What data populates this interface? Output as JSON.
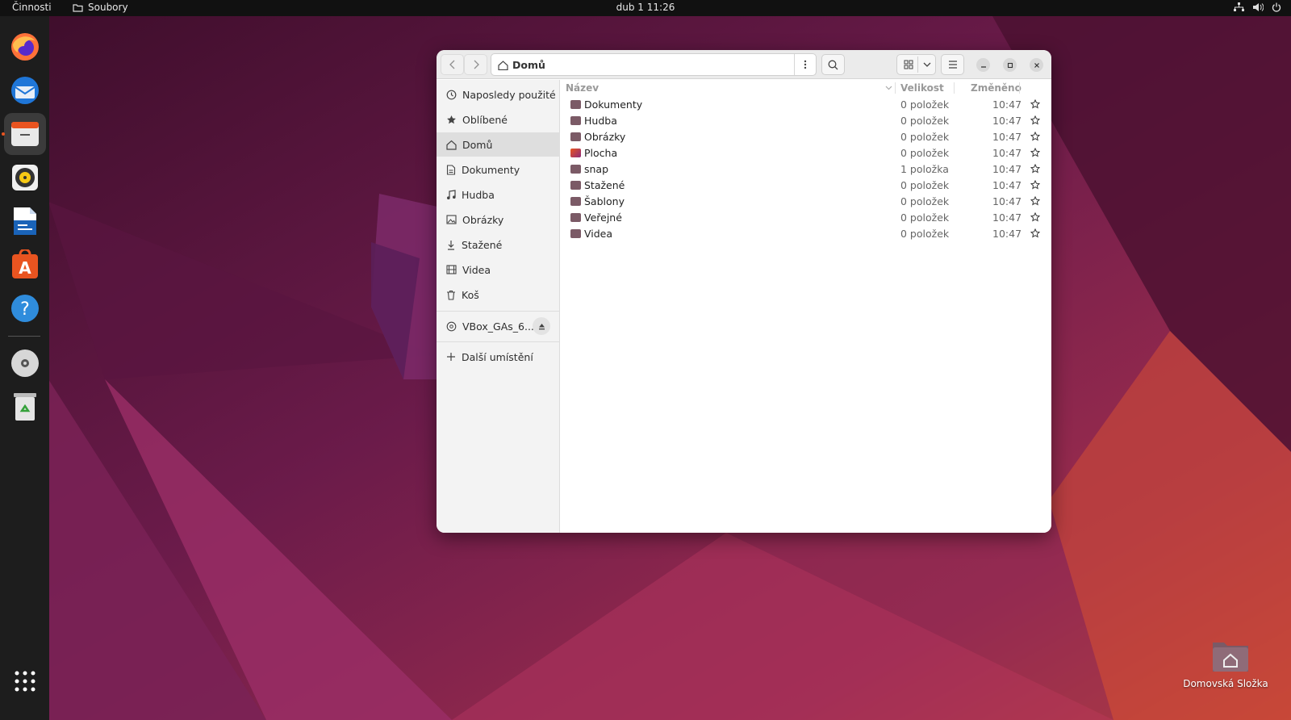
{
  "topbar": {
    "activities": "Činnosti",
    "app_name": "Soubory",
    "clock": "dub 1  11:26"
  },
  "dock": {
    "items": [
      "firefox-icon",
      "thunderbird-icon",
      "files-icon",
      "rhythmbox-icon",
      "writer-icon",
      "app-center-icon",
      "help-icon",
      "cd-icon",
      "trash-icon",
      "show-apps-icon"
    ]
  },
  "desktop": {
    "home_folder_label": "Domovská Složka"
  },
  "window": {
    "path_label": "Domů",
    "sidebar": {
      "items": [
        {
          "label": "Naposledy použité",
          "icon": "clock-icon"
        },
        {
          "label": "Oblíbené",
          "icon": "star-icon"
        },
        {
          "label": "Domů",
          "icon": "home-icon"
        },
        {
          "label": "Dokumenty",
          "icon": "document-icon"
        },
        {
          "label": "Hudba",
          "icon": "music-icon"
        },
        {
          "label": "Obrázky",
          "icon": "image-icon"
        },
        {
          "label": "Stažené",
          "icon": "download-icon"
        },
        {
          "label": "Videa",
          "icon": "film-icon"
        },
        {
          "label": "Koš",
          "icon": "trash-icon"
        }
      ],
      "device": "VBox_GAs_6....",
      "other_locations": "Další umístění"
    },
    "columns": {
      "name": "Název",
      "size": "Velikost",
      "modified": "Změněno"
    },
    "files": [
      {
        "name": "Dokumenty",
        "size": "0 položek",
        "modified": "10:47"
      },
      {
        "name": "Hudba",
        "size": "0 položek",
        "modified": "10:47"
      },
      {
        "name": "Obrázky",
        "size": "0 položek",
        "modified": "10:47"
      },
      {
        "name": "Plocha",
        "size": "0 položek",
        "modified": "10:47"
      },
      {
        "name": "snap",
        "size": "1 položka",
        "modified": "10:47"
      },
      {
        "name": "Stažené",
        "size": "0 položek",
        "modified": "10:47"
      },
      {
        "name": "Šablony",
        "size": "0 položek",
        "modified": "10:47"
      },
      {
        "name": "Veřejné",
        "size": "0 položek",
        "modified": "10:47"
      },
      {
        "name": "Videa",
        "size": "0 položek",
        "modified": "10:47"
      }
    ]
  }
}
